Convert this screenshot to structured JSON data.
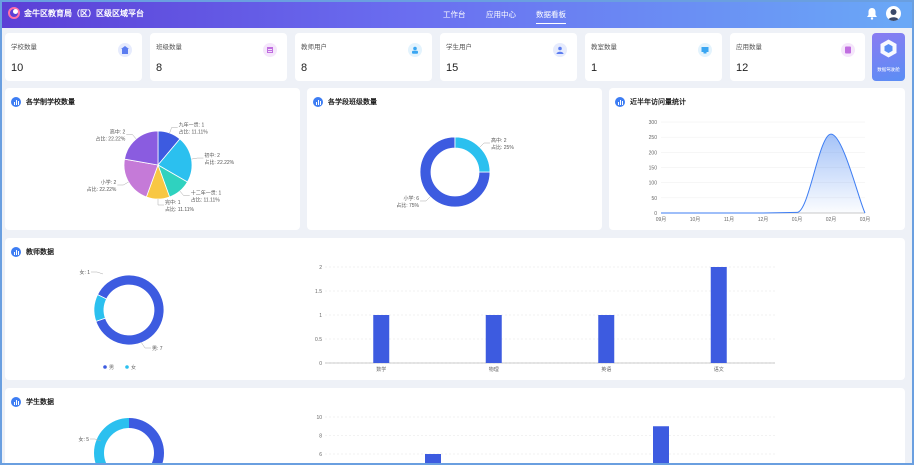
{
  "header": {
    "brand": "金牛区教育局（区）区级区域平台",
    "nav": [
      "工作台",
      "应用中心",
      "数据看板"
    ],
    "active_nav": "数据看板"
  },
  "stats": [
    {
      "label": "学校数量",
      "value": "10",
      "icon": "school-icon",
      "color": "#5b7cf0"
    },
    {
      "label": "班级数量",
      "value": "8",
      "icon": "class-icon",
      "color": "#c06ee0"
    },
    {
      "label": "教师用户",
      "value": "8",
      "icon": "teacher-icon",
      "color": "#3aa6f2"
    },
    {
      "label": "学生用户",
      "value": "15",
      "icon": "student-icon",
      "color": "#5b7cf0"
    },
    {
      "label": "教室数量",
      "value": "1",
      "icon": "classroom-icon",
      "color": "#3aa6f2"
    },
    {
      "label": "应用数量",
      "value": "12",
      "icon": "app-icon",
      "color": "#c06ee0"
    }
  ],
  "side_button": {
    "label": "数据驾驶舱",
    "icon": "cockpit-icon"
  },
  "panels": {
    "school_type": {
      "title": "各学制学校数量"
    },
    "grade_class": {
      "title": "各学段班级数量"
    },
    "visits": {
      "title": "近半年访问量统计"
    },
    "teacher": {
      "title": "教师数据"
    },
    "student": {
      "title": "学生数据"
    }
  },
  "chart_data": [
    {
      "type": "pie",
      "title": "各学制学校数量",
      "slices": [
        {
          "name": "九年一贯",
          "value": 1,
          "pct": "11.11%",
          "color": "#3d5be0"
        },
        {
          "name": "初中",
          "value": 2,
          "pct": "22.22%",
          "color": "#2bc0ef"
        },
        {
          "name": "十二年一贯",
          "value": 1,
          "pct": "11.11%",
          "color": "#2fd2bf"
        },
        {
          "name": "完中",
          "value": 1,
          "pct": "11.11%",
          "color": "#f8c743"
        },
        {
          "name": "小学",
          "value": 2,
          "pct": "22.22%",
          "color": "#c57ad8"
        },
        {
          "name": "高中",
          "value": 2,
          "pct": "22.22%",
          "color": "#8a5ce0"
        }
      ]
    },
    {
      "type": "pie",
      "title": "各学段班级数量",
      "slices": [
        {
          "name": "小学",
          "value": 6,
          "pct": "75%",
          "color": "#3d5be0"
        },
        {
          "name": "高中",
          "value": 2,
          "pct": "25%",
          "color": "#2bc0ef"
        }
      ]
    },
    {
      "type": "area",
      "title": "近半年访问量统计",
      "categories": [
        "09月",
        "10月",
        "11月",
        "12月",
        "01月",
        "02月",
        "03月"
      ],
      "values": [
        0,
        0,
        0,
        0,
        2,
        260,
        0
      ],
      "ylim": [
        0,
        300
      ],
      "yticks": [
        0,
        50,
        100,
        150,
        200,
        250,
        300
      ]
    },
    {
      "type": "pie",
      "title": "教师数据",
      "slices": [
        {
          "name": "男",
          "value": 7,
          "color": "#3d5be0"
        },
        {
          "name": "女",
          "value": 1,
          "color": "#2bc0ef"
        }
      ],
      "legend": [
        "男",
        "女"
      ]
    },
    {
      "type": "bar",
      "title": "教师数据",
      "categories": [
        "数学",
        "物理",
        "英语",
        "语文"
      ],
      "values": [
        1,
        1,
        1,
        2
      ],
      "ylim": [
        0,
        2
      ],
      "yticks": [
        "0",
        "0.5",
        "1",
        "1.5",
        "2"
      ]
    },
    {
      "type": "pie",
      "title": "学生数据",
      "slices": [
        {
          "name": "女",
          "value": 5,
          "color": "#2bc0ef"
        }
      ]
    },
    {
      "type": "bar",
      "title": "学生数据",
      "values_visible": [
        6,
        9
      ],
      "ylim": [
        0,
        10
      ],
      "yticks": [
        "10",
        "8",
        "6"
      ]
    }
  ]
}
